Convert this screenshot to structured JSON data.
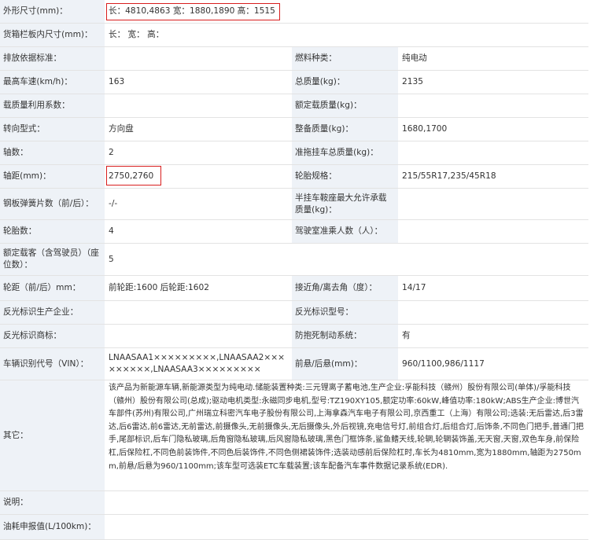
{
  "rows": [
    {
      "l1": "外形尺寸(mm)：",
      "v1": "长：4810,4863 宽：1880,1890 高：1515"
    },
    {
      "l1": "货箱栏板内尺寸(mm)：",
      "v1": "长： 宽： 高："
    },
    {
      "l1": "排放依据标准：",
      "v1": "",
      "l2": "燃料种类：",
      "v2": "纯电动"
    },
    {
      "l1": "最高车速(km/h)：",
      "v1": "163",
      "l2": "总质量(kg)：",
      "v2": "2135"
    },
    {
      "l1": "载质量利用系数：",
      "v1": "",
      "l2": "额定载质量(kg)：",
      "v2": ""
    },
    {
      "l1": "转向型式：",
      "v1": "方向盘",
      "l2": "整备质量(kg)：",
      "v2": "1680,1700"
    },
    {
      "l1": "轴数：",
      "v1": "2",
      "l2": "准拖挂车总质量(kg)：",
      "v2": ""
    },
    {
      "l1": "轴距(mm)：",
      "v1": "2750,2760",
      "l2": "轮胎规格：",
      "v2": "215/55R17,235/45R18"
    },
    {
      "l1": "钢板弹簧片数（前/后）：",
      "v1": "-/-",
      "l2": "半挂车鞍座最大允许承载质量(kg)：",
      "v2": ""
    },
    {
      "l1": "轮胎数：",
      "v1": "4",
      "l2": "驾驶室准乘人数（人）：",
      "v2": ""
    },
    {
      "l1": "额定载客（含驾驶员）（座位数）：",
      "v1": "5"
    },
    {
      "l1": "轮距（前/后）mm：",
      "v1": "前轮距:1600 后轮距:1602",
      "l2": "接近角/离去角（度）：",
      "v2": "14/17"
    },
    {
      "l1": "反光标识生产企业：",
      "v1": "",
      "l2": "反光标识型号：",
      "v2": ""
    },
    {
      "l1": "反光标识商标：",
      "v1": "",
      "l2": "防抱死制动系统：",
      "v2": "有"
    },
    {
      "l1": "车辆识别代号（VIN）：",
      "v1": "LNAASAA1×××××××××,LNAASAA2×××××××××,LNAASAA3×××××××××",
      "l2": "前悬/后悬(mm)：",
      "v2": "960/1100,986/1117"
    },
    {
      "l1": "其它：",
      "v1": "该产品为新能源车辆,新能源类型为纯电动.储能装置种类:三元锂离子蓄电池,生产企业:孚能科技（赣州）股份有限公司(单体)/孚能科技（赣州）股份有限公司(总成);驱动电机类型:永磁同步电机,型号:TZ190XY105,额定功率:60kW,峰值功率:180kW;ABS生产企业:博世汽车部件(苏州)有限公司,广州瑞立科密汽车电子股份有限公司,上海拿森汽车电子有限公司,京西重工（上海）有限公司;选装:无后雷达,后3雷达,后6雷达,前6雷达,无前雷达,前摄像头,无前摄像头,无后摄像头,外后视镜,充电信号灯,前组合灯,后组合灯,后饰条,不同色门把手,普通门把手,尾部标识,后车门隐私玻璃,后角窗隐私玻璃,后风窗隐私玻璃,黑色门框饰条,鲨鱼鳍天线,轮辋,轮辋装饰盖,无天窗,天窗,双色车身,前保险杠,后保险杠,不同色前装饰件,不同色后装饰件,不同色侧裙装饰件;选装动感前后保险杠时,车长为4810mm,宽为1880mm,轴距为2750mm,前悬/后悬为960/1100mm;该车型可选装ETC车载装置;该车配备汽车事件数据记录系统(EDR)."
    },
    {
      "l1": "说明：",
      "v1": ""
    },
    {
      "l1": "油耗申报值(L/100km)：",
      "v1": ""
    }
  ]
}
